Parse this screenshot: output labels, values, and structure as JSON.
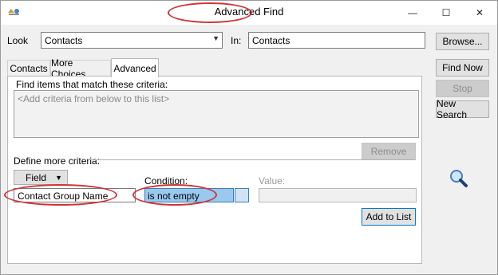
{
  "window": {
    "title": "Advanced Find",
    "controls": {
      "minimize": "—",
      "maximize": "☐",
      "close": "✕"
    }
  },
  "top": {
    "look_label": "Look",
    "look_value": "Contacts",
    "in_label": "In:",
    "in_value": "Contacts",
    "browse_label": "Browse..."
  },
  "tabs": [
    {
      "label": "Contacts"
    },
    {
      "label": "More Choices"
    },
    {
      "label": "Advanced",
      "active": true
    }
  ],
  "advanced": {
    "match_label": "Find items that match these criteria:",
    "criteria_placeholder": "<Add criteria from below to this list>",
    "remove_label": "Remove",
    "define_label": "Define more criteria:",
    "field_button_label": "Field",
    "field_value": "Contact Group Name",
    "condition_label": "Condition:",
    "condition_value": "is not empty",
    "value_label": "Value:",
    "value_value": "",
    "add_to_list_label": "Add to List"
  },
  "side_buttons": {
    "find_now": "Find Now",
    "stop": "Stop",
    "new_search": "New Search"
  },
  "icons": {
    "app": "outlook-find-icon",
    "search": "magnifier-icon"
  },
  "colors": {
    "highlight_oval": "#d13438",
    "selection": "#99c9ef"
  }
}
